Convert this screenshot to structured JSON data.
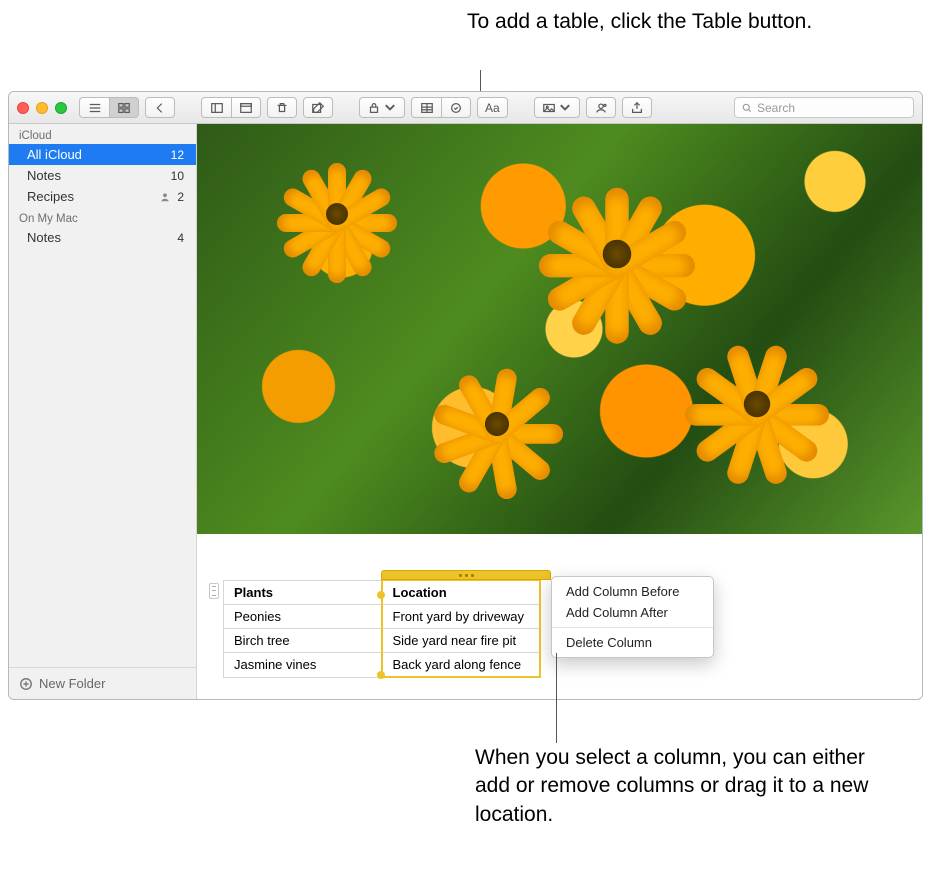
{
  "callouts": {
    "top": "To add a table, click the Table button.",
    "bottom": "When you select a column, you can either add or remove columns or drag it to a new location."
  },
  "toolbar": {
    "view_list_icon": "list-view-icon",
    "view_grid_icon": "gallery-view-icon",
    "back_icon": "chevron-left-icon",
    "attachments_icon": "attachments-icon",
    "delete_icon": "trash-icon",
    "new_note_icon": "compose-icon",
    "lock_icon": "lock-icon",
    "table_icon": "table-icon",
    "checklist_icon": "checklist-icon",
    "format_label": "Aa",
    "media_icon": "photo-icon",
    "collab_icon": "add-people-icon",
    "share_icon": "share-icon"
  },
  "search": {
    "placeholder": "Search"
  },
  "sidebar": {
    "sections": [
      {
        "title": "iCloud",
        "items": [
          {
            "label": "All iCloud",
            "count": "12",
            "selected": true,
            "shared": false
          },
          {
            "label": "Notes",
            "count": "10",
            "selected": false,
            "shared": false
          },
          {
            "label": "Recipes",
            "count": "2",
            "selected": false,
            "shared": true
          }
        ]
      },
      {
        "title": "On My Mac",
        "items": [
          {
            "label": "Notes",
            "count": "4",
            "selected": false,
            "shared": false
          }
        ]
      }
    ],
    "new_folder_label": "New Folder"
  },
  "note_table": {
    "headers": [
      "Plants",
      "Location"
    ],
    "rows": [
      [
        "Peonies",
        "Front yard by driveway"
      ],
      [
        "Birch tree",
        "Side yard near fire pit"
      ],
      [
        "Jasmine vines",
        "Back yard along fence"
      ]
    ],
    "selected_column_index": 1
  },
  "context_menu": {
    "items": [
      "Add Column Before",
      "Add Column After"
    ],
    "items2": [
      "Delete Column"
    ]
  }
}
